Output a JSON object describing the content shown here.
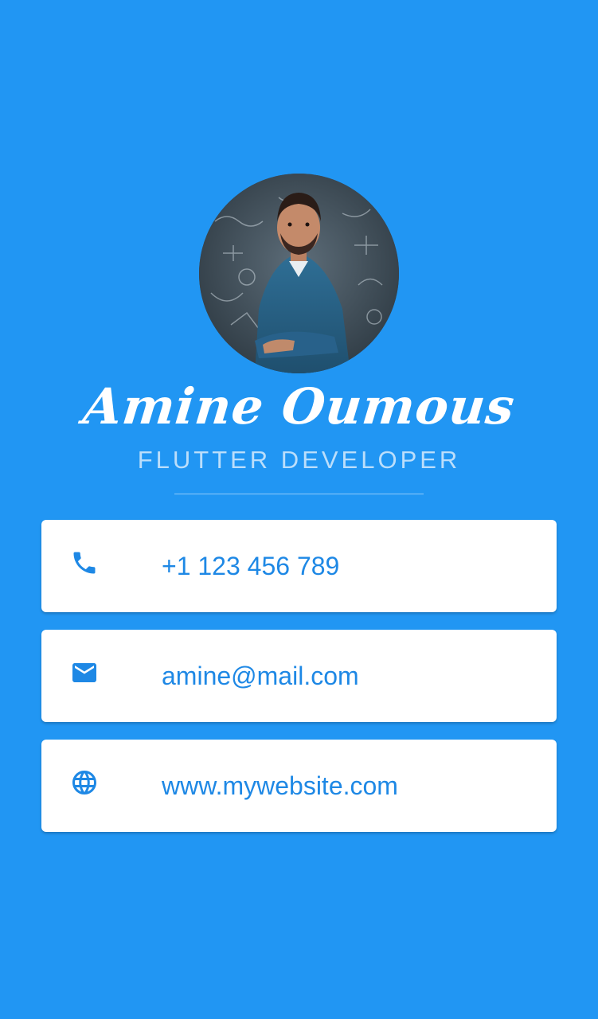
{
  "profile": {
    "name": "Amine Oumous",
    "title": "FLUTTER DEVELOPER"
  },
  "contacts": [
    {
      "icon": "phone-icon",
      "value": "+1 123 456 789"
    },
    {
      "icon": "mail-icon",
      "value": "amine@mail.com"
    },
    {
      "icon": "globe-icon",
      "value": "www.mywebsite.com"
    }
  ],
  "colors": {
    "background": "#2196F3",
    "card": "#FFFFFF",
    "accent": "#1E88E5",
    "subtitle": "#BBDEFB"
  }
}
